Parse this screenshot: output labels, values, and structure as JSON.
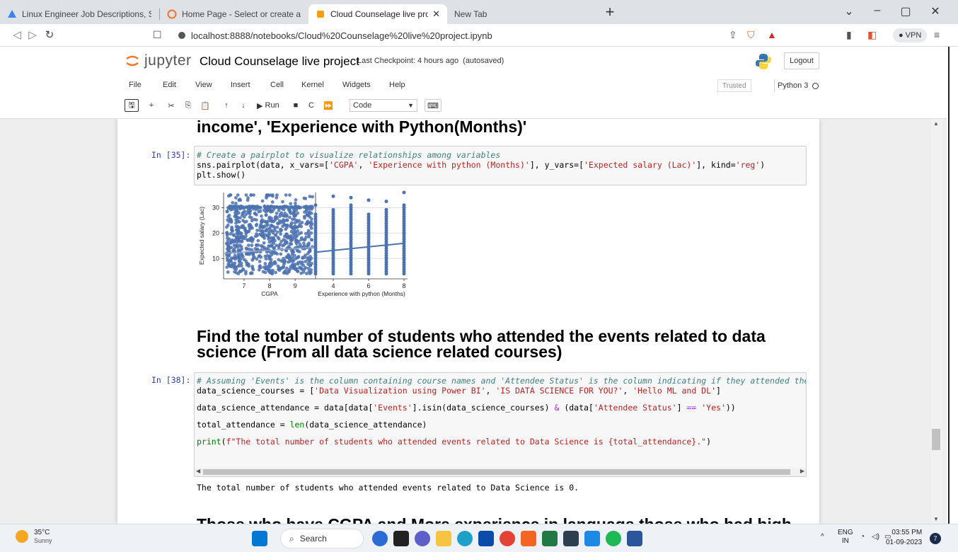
{
  "browser": {
    "tabs": [
      {
        "title": "Linux Engineer Job Descriptions, Salar"
      },
      {
        "title": "Home Page - Select or create a notebo"
      },
      {
        "title": "Cloud Counselage live project - Ju"
      },
      {
        "title": "New Tab"
      }
    ],
    "url": "localhost:8888/notebooks/Cloud%20Counselage%20live%20project.ipynb",
    "vpn_label": "VPN"
  },
  "jupyter": {
    "logo_text": "jupyter",
    "notebook_title": "Cloud Counselage live project",
    "checkpoint": "Last Checkpoint: 4 hours ago",
    "autosave": "(autosaved)",
    "logout_label": "Logout",
    "menus": [
      "File",
      "Edit",
      "View",
      "Insert",
      "Cell",
      "Kernel",
      "Widgets",
      "Help"
    ],
    "trusted_label": "Trusted",
    "kernel_name": "Python 3",
    "run_label": "Run",
    "cell_type": "Code"
  },
  "notebook": {
    "heading_top": "income', 'Experience with Python(Months)'",
    "cell35_prompt": "In [35]:",
    "cell35_comment": "# Create a pairplot to visualize relationships among variables",
    "cell35_line2a": "sns.pairplot(data, x_vars=[",
    "cell35_s1": "'CGPA'",
    "cell35_s2": "'Experience with python (Months)'",
    "cell35_mid": "], y_vars=[",
    "cell35_s3": "'Expected salary (Lac)'",
    "cell35_mid2": "], kind=",
    "cell35_s4": "'reg'",
    "cell35_line3": "plt.show()",
    "heading_2": "Find the total number of students who attended the events related to data science (From all data science related courses)",
    "cell38_prompt": "In [38]:",
    "cell38_comment": "# Assuming 'Events' is the column containing course names and 'Attendee Status' is the column indicating if they attended the eve",
    "cell38_l2a": "data_science_courses = [",
    "cell38_l2s1": "'Data Visualization using Power BI'",
    "cell38_l2s2": "'IS DATA SCIENCE FOR YOU?'",
    "cell38_l2s3": "'Hello ML and DL'",
    "cell38_l3a": "data_science_attendance = data[data[",
    "cell38_l3s1": "'Events'",
    "cell38_l3b": "].isin(data_science_courses) ",
    "cell38_l3c": "(data[",
    "cell38_l3s2": "'Attendee Status'",
    "cell38_l3d": "] ",
    "cell38_l3e": "'Yes'",
    "cell38_l4a": "total_attendance = ",
    "cell38_l4b": "len",
    "cell38_l4c": "(data_science_attendance)",
    "cell38_l5a": "print",
    "cell38_l5b": "(",
    "cell38_l5s": "f\"The total number of students who attended events related to Data Science is {total_attendance}.\"",
    "cell38_output": "The total number of students who attended events related to Data Science is 0.",
    "heading_3": "Those who have CGPA and More experience in language those who had high"
  },
  "chart_data": {
    "type": "scatter",
    "title": "",
    "ylabel": "Expected salary (Lac)",
    "ylim": [
      2,
      36
    ],
    "yticks": [
      10,
      20,
      30
    ],
    "panels": [
      {
        "xlabel": "CGPA",
        "xticks": [
          7,
          8,
          9
        ],
        "xlim": [
          6.2,
          9.8
        ]
      },
      {
        "xlabel": "Experience with python (Months)",
        "xticks": [
          4,
          6,
          8
        ],
        "xlim": [
          3.0,
          8.2
        ],
        "stripes_x": [
          3,
          4,
          5,
          6,
          7,
          8
        ],
        "trend": [
          [
            3,
            12.5
          ],
          [
            8,
            16
          ]
        ]
      }
    ]
  },
  "taskbar": {
    "temperature": "35°C",
    "condition": "Sunny",
    "search_label": "Search",
    "lang": "ENG",
    "region": "IN",
    "time": "03:55 PM",
    "date": "01-09-2023"
  }
}
